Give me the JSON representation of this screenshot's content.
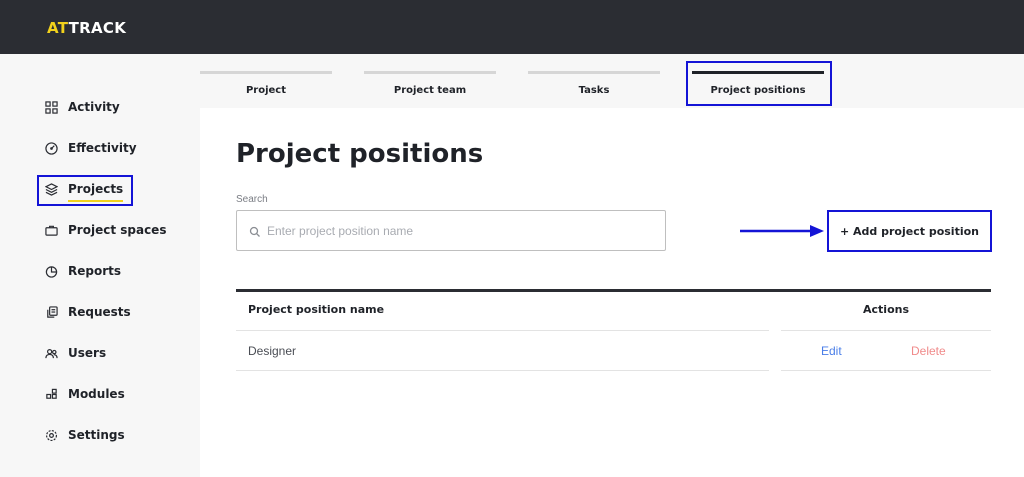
{
  "app": {
    "logo_accent": "AT",
    "logo_rest": "TRACK",
    "accent_color": "#f2d11c",
    "highlight_color": "#1414d6"
  },
  "sidebar": {
    "items": [
      {
        "label": "Activity",
        "icon": "grid-icon"
      },
      {
        "label": "Effectivity",
        "icon": "gauge-icon"
      },
      {
        "label": "Projects",
        "icon": "layers-icon",
        "active": true
      },
      {
        "label": "Project spaces",
        "icon": "briefcase-icon"
      },
      {
        "label": "Reports",
        "icon": "pie-chart-icon"
      },
      {
        "label": "Requests",
        "icon": "requests-icon"
      },
      {
        "label": "Users",
        "icon": "users-icon"
      },
      {
        "label": "Modules",
        "icon": "modules-icon"
      },
      {
        "label": "Settings",
        "icon": "gear-icon"
      }
    ]
  },
  "tabs": [
    {
      "label": "Project"
    },
    {
      "label": "Project team"
    },
    {
      "label": "Tasks"
    },
    {
      "label": "Project positions",
      "active": true
    }
  ],
  "main": {
    "title": "Project positions",
    "search": {
      "label": "Search",
      "placeholder": "Enter project position name",
      "value": ""
    },
    "add_button_label": "+ Add project position"
  },
  "table": {
    "columns": [
      "Project position name",
      "Actions"
    ],
    "rows": [
      {
        "name": "Designer",
        "edit_label": "Edit",
        "delete_label": "Delete"
      }
    ]
  }
}
